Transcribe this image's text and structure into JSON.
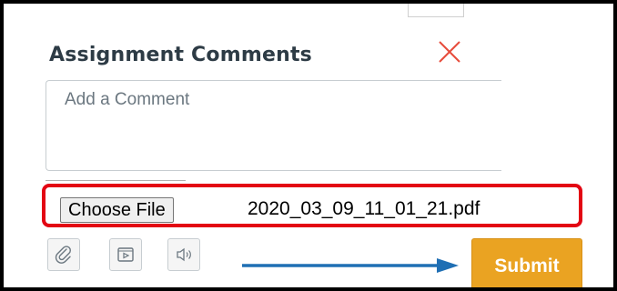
{
  "panel": {
    "title": "Assignment Comments"
  },
  "comment": {
    "placeholder": "Add a Comment"
  },
  "file_input": {
    "button_label": "Choose File",
    "file_name": "2020_03_09_11_01_21.pdf"
  },
  "tools": [
    {
      "icon": "paperclip-icon"
    },
    {
      "icon": "media-play-icon"
    },
    {
      "icon": "audio-speaker-icon"
    }
  ],
  "submit": {
    "label": "Submit"
  },
  "colors": {
    "highlight_border": "#e30613",
    "close_icon": "#e74c3c",
    "submit_bg": "#eaa322",
    "arrow": "#1f6fb4",
    "title": "#2d3b45"
  }
}
